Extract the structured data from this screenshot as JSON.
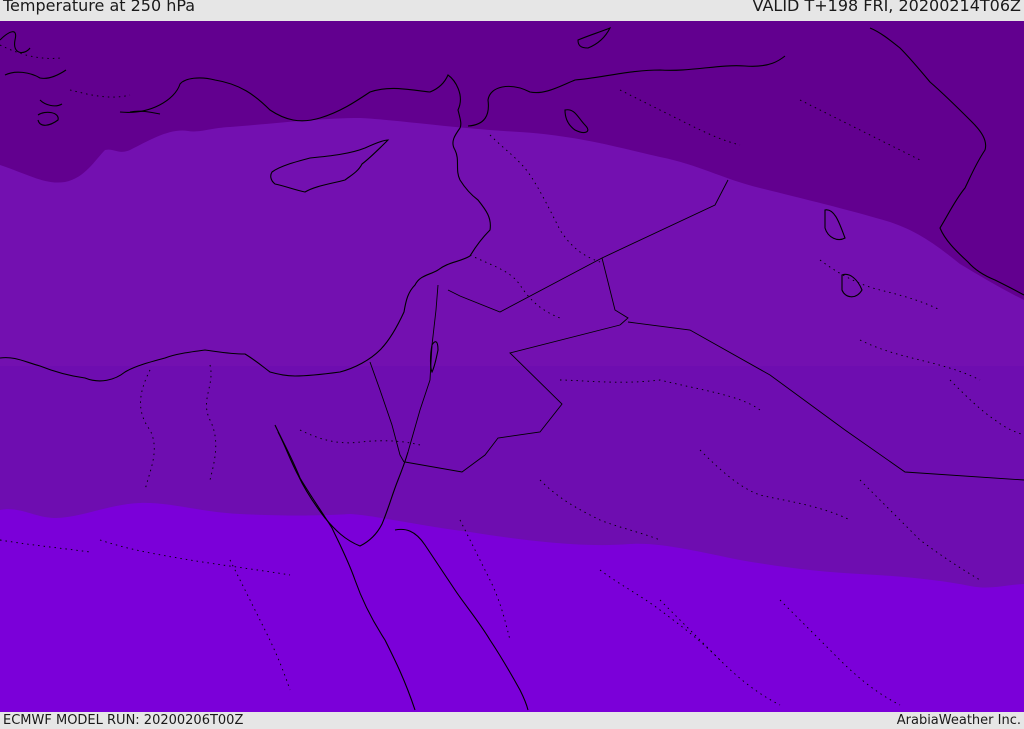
{
  "header": {
    "title": "Temperature at 250 hPa",
    "valid": "VALID T+198 FRI, 20200214T06Z"
  },
  "footer": {
    "model_run": "ECMWF MODEL RUN: 20200206T00Z",
    "credit": "ArabiaWeather Inc."
  },
  "map": {
    "region": "Eastern Mediterranean and Middle East",
    "temperature_bands": [
      {
        "name": "coldest-band",
        "color": "#62008f"
      },
      {
        "name": "middle-band",
        "color": "#7310b0"
      },
      {
        "name": "southern-band",
        "color": "#6e0db0"
      },
      {
        "name": "warmest-band",
        "color": "#7b00d9"
      }
    ],
    "border_color": "#000000"
  }
}
